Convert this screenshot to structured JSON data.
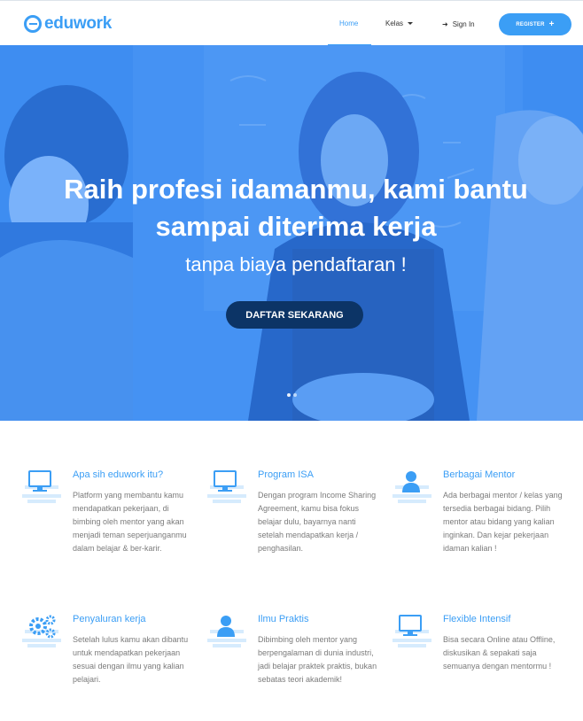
{
  "brand": {
    "name": "eduwork",
    "accent": "#3b9ef5",
    "dark": "#0c3466"
  },
  "nav": {
    "home": "Home",
    "kelas": "Kelas",
    "signin": "Sign In",
    "register": "REGISTER"
  },
  "hero": {
    "title_line1": "Raih profesi idamanmu, kami bantu",
    "title_line2": "sampai diterima kerja",
    "subtitle": "tanpa biaya pendaftaran !",
    "cta": "DAFTAR SEKARANG",
    "slides": 2
  },
  "features": [
    {
      "title": "Apa sih eduwork itu?",
      "desc": "Platform yang membantu kamu mendapatkan pekerjaan, di bimbing oleh mentor yang akan menjadi teman seperjuanganmu dalam belajar & ber-karir.",
      "icon": "monitor-icon"
    },
    {
      "title": "Program ISA",
      "desc": "Dengan program Income Sharing Agreement, kamu bisa fokus belajar dulu, bayarnya nanti setelah mendapatkan kerja / penghasilan.",
      "icon": "monitor-icon"
    },
    {
      "title": "Berbagai Mentor",
      "desc": "Ada berbagai mentor / kelas yang tersedia berbagai bidang. Pilih mentor atau bidang yang kalian inginkan. Dan kejar pekerjaan idaman kalian !",
      "icon": "user-icon"
    },
    {
      "title": "Penyaluran kerja",
      "desc": "Setelah lulus kamu akan dibantu untuk mendapatkan pekerjaan sesuai dengan ilmu yang kalian pelajari.",
      "icon": "gears-icon"
    },
    {
      "title": "Ilmu Praktis",
      "desc": "Dibimbing oleh mentor yang berpengalaman di dunia industri, jadi belajar praktek praktis, bukan sebatas teori akademik!",
      "icon": "user-icon"
    },
    {
      "title": "Flexible Intensif",
      "desc": "Bisa secara Online atau Offline, diskusikan & sepakati saja semuanya dengan mentormu !",
      "icon": "monitor-icon"
    }
  ]
}
